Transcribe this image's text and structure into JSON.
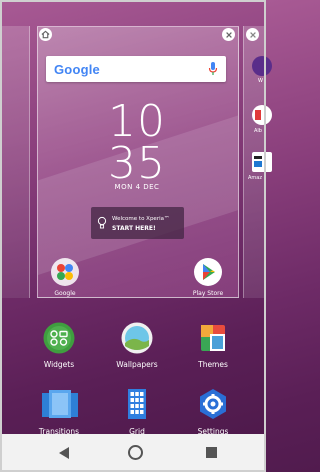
{
  "search": {
    "logo_text": "Google",
    "mic": "mic-icon"
  },
  "clock": {
    "hours": "10",
    "minutes": "35",
    "date": "MON 4 DEC"
  },
  "welcome": {
    "line1": "Welcome to Xperia™",
    "line2": "START HERE!"
  },
  "home_apps": [
    {
      "label": "Google",
      "icon": "google-folder-icon"
    },
    {
      "label": "Play Store",
      "icon": "play-store-icon"
    }
  ],
  "right_page_labels": [
    "W",
    "Alb",
    "Amaz"
  ],
  "options": [
    {
      "label": "Widgets",
      "icon": "widgets-icon"
    },
    {
      "label": "Wallpapers",
      "icon": "wallpapers-icon"
    },
    {
      "label": "Themes",
      "icon": "themes-icon"
    },
    {
      "label": "Transitions",
      "icon": "transitions-icon"
    },
    {
      "label": "Grid",
      "icon": "grid-icon"
    },
    {
      "label": "Settings",
      "icon": "settings-icon"
    }
  ],
  "nav": {
    "back": "back-icon",
    "home": "home-icon",
    "recent": "recent-apps-icon"
  },
  "colors": {
    "accent_green": "#4caf50",
    "settings_blue": "#2a6fd6",
    "grid_blue": "#2f7fe0"
  }
}
